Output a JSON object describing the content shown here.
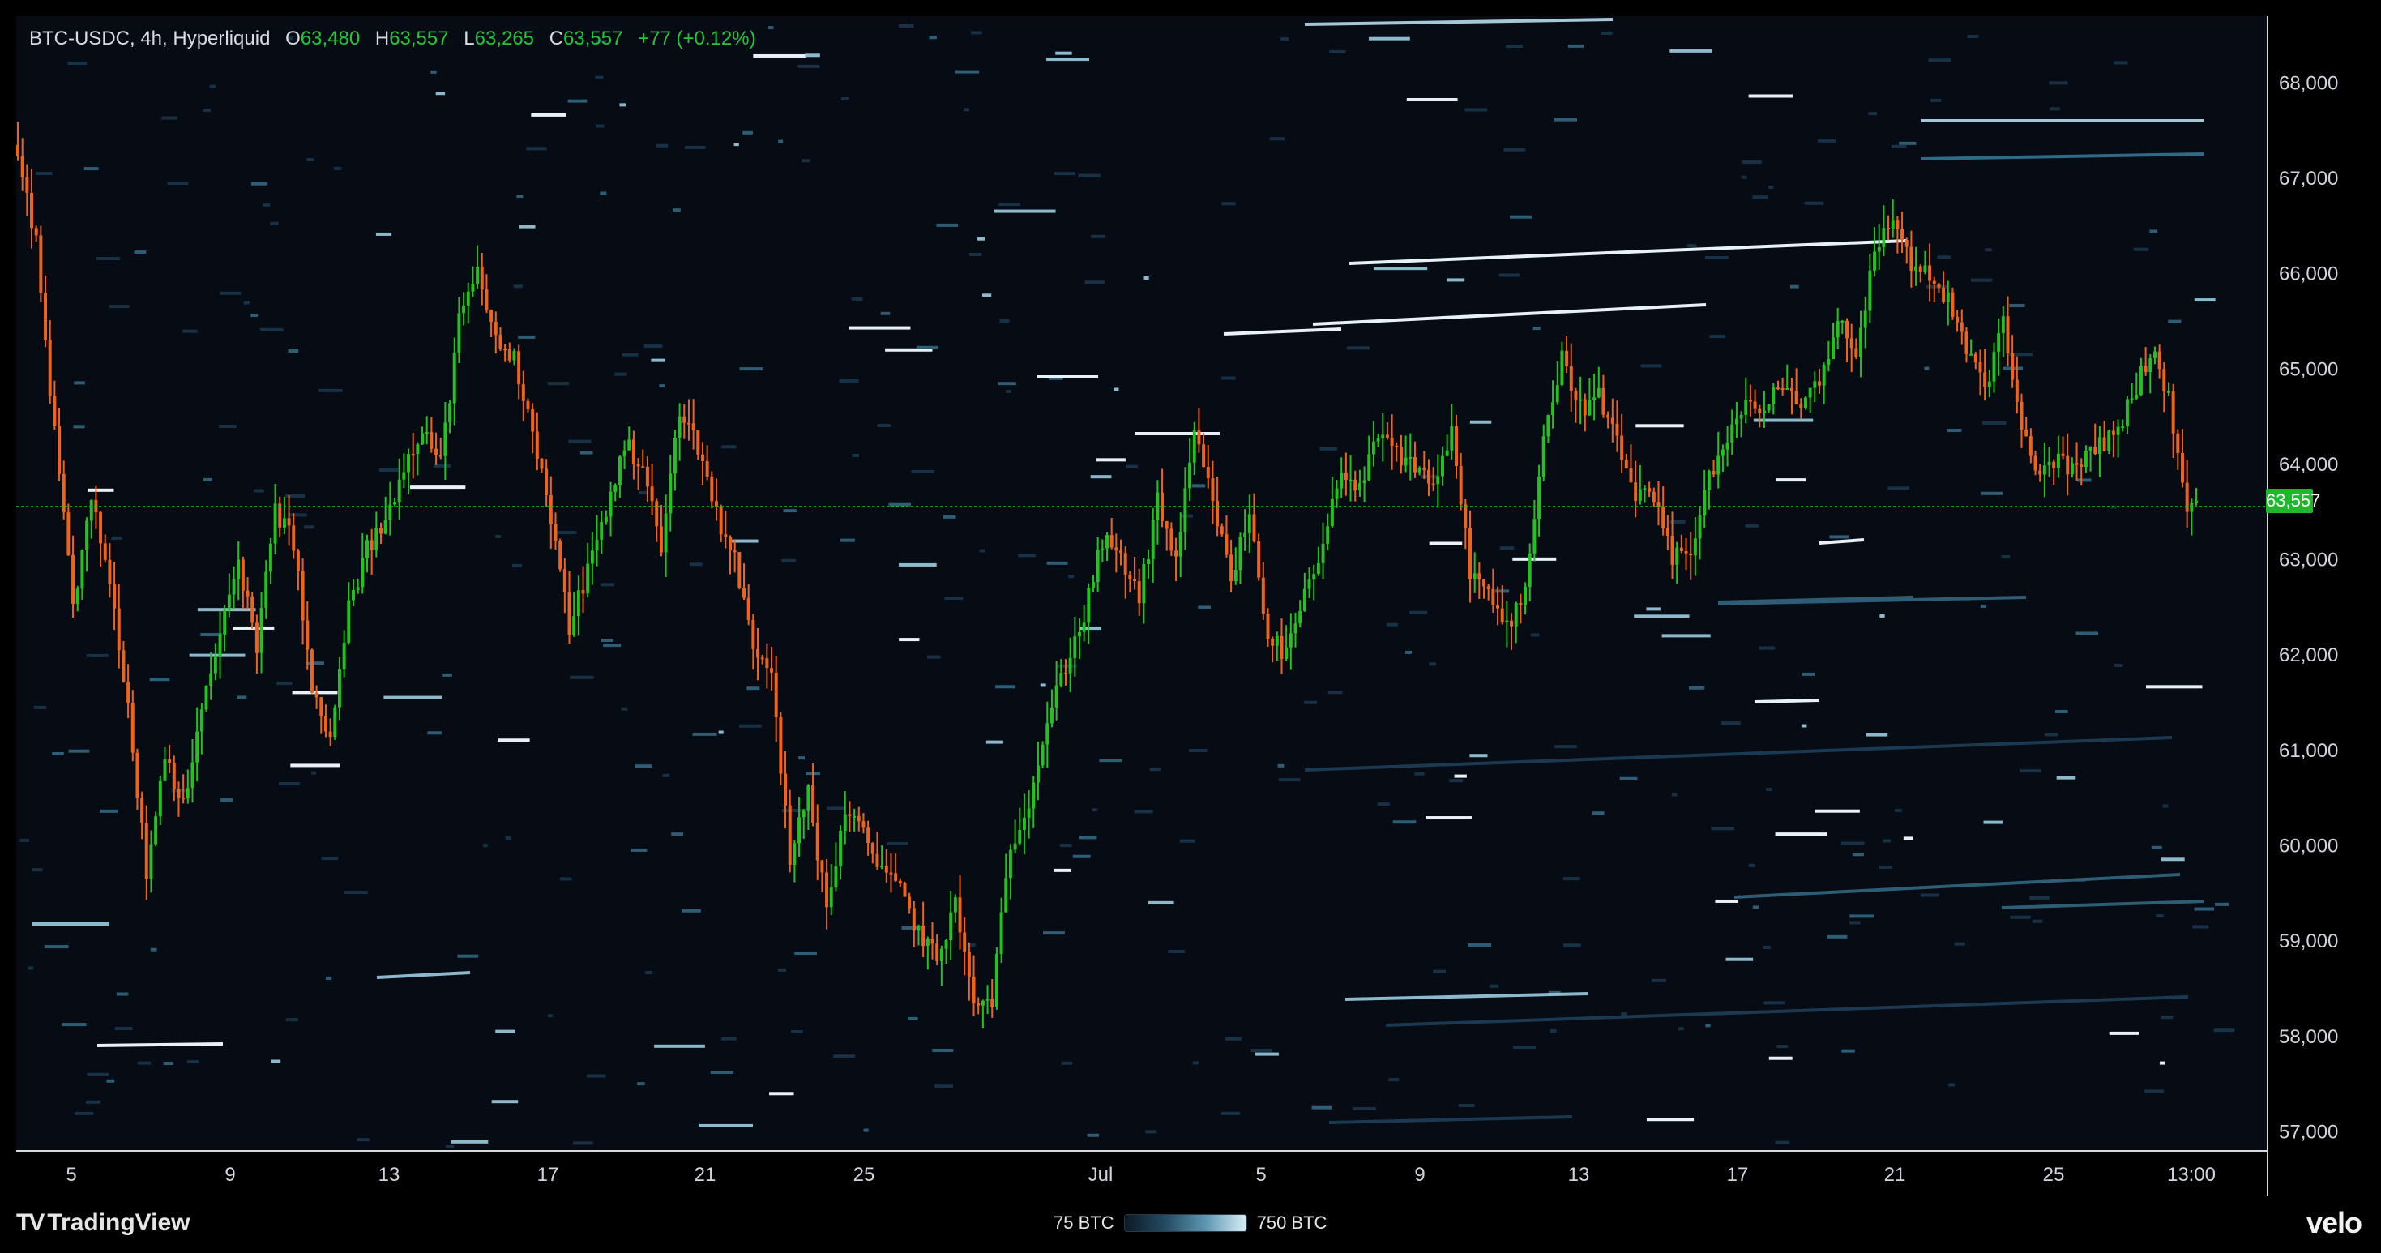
{
  "header": {
    "symbol": "BTC-USDC, 4h, Hyperliquid",
    "open_label": "O",
    "open": "63,480",
    "high_label": "H",
    "high": "63,557",
    "low_label": "L",
    "low": "63,265",
    "close_label": "C",
    "close": "63,557",
    "change": "+77 (+0.12%)"
  },
  "last_price_tag": "63,557",
  "footer": {
    "brand": "TradingView",
    "scale_min": "75 BTC",
    "scale_max": "750 BTC",
    "right_brand": "velo"
  },
  "colors": {
    "background": "#060b14",
    "up": "#22c21f",
    "down": "#f2631a",
    "liquidity_low": "#1b3a52",
    "liquidity_high": "#e8f2f6",
    "price_line": "#1eb82f"
  },
  "chart_data": {
    "type": "candlestick",
    "timeframe": "4h",
    "x_ticks": [
      "5",
      "9",
      "13",
      "17",
      "21",
      "25",
      "Jul",
      "5",
      "9",
      "13",
      "17",
      "21",
      "25",
      "13:00"
    ],
    "y_ticks": [
      57000,
      58000,
      59000,
      60000,
      61000,
      62000,
      63000,
      64000,
      65000,
      66000,
      67000,
      68000
    ],
    "ylim": [
      56800,
      68700
    ],
    "last_price": 63557,
    "close_path_keypoints": [
      [
        0,
        67200
      ],
      [
        4,
        66300
      ],
      [
        8,
        64300
      ],
      [
        12,
        62500
      ],
      [
        16,
        63600
      ],
      [
        20,
        62800
      ],
      [
        24,
        61500
      ],
      [
        28,
        59700
      ],
      [
        32,
        61000
      ],
      [
        36,
        60400
      ],
      [
        40,
        61400
      ],
      [
        44,
        62200
      ],
      [
        48,
        63000
      ],
      [
        52,
        62100
      ],
      [
        56,
        63500
      ],
      [
        60,
        63200
      ],
      [
        64,
        61600
      ],
      [
        68,
        61100
      ],
      [
        72,
        62500
      ],
      [
        76,
        63100
      ],
      [
        80,
        63400
      ],
      [
        84,
        64000
      ],
      [
        88,
        64400
      ],
      [
        92,
        64000
      ],
      [
        96,
        65500
      ],
      [
        100,
        66000
      ],
      [
        104,
        65300
      ],
      [
        108,
        65100
      ],
      [
        112,
        64400
      ],
      [
        116,
        63400
      ],
      [
        120,
        62300
      ],
      [
        124,
        62900
      ],
      [
        128,
        63500
      ],
      [
        132,
        64200
      ],
      [
        136,
        64000
      ],
      [
        140,
        63100
      ],
      [
        144,
        64600
      ],
      [
        148,
        64200
      ],
      [
        152,
        63500
      ],
      [
        156,
        63000
      ],
      [
        160,
        62100
      ],
      [
        164,
        61900
      ],
      [
        168,
        59800
      ],
      [
        172,
        60600
      ],
      [
        176,
        59300
      ],
      [
        180,
        60400
      ],
      [
        184,
        60100
      ],
      [
        188,
        59800
      ],
      [
        192,
        59500
      ],
      [
        196,
        59100
      ],
      [
        200,
        58800
      ],
      [
        204,
        59400
      ],
      [
        208,
        58300
      ],
      [
        212,
        58400
      ],
      [
        216,
        60000
      ],
      [
        220,
        60500
      ],
      [
        224,
        61300
      ],
      [
        228,
        61900
      ],
      [
        232,
        62400
      ],
      [
        236,
        63200
      ],
      [
        240,
        63000
      ],
      [
        244,
        62600
      ],
      [
        248,
        63600
      ],
      [
        252,
        63000
      ],
      [
        256,
        64300
      ],
      [
        260,
        63600
      ],
      [
        264,
        62800
      ],
      [
        268,
        63500
      ],
      [
        272,
        62200
      ],
      [
        276,
        62000
      ],
      [
        280,
        62600
      ],
      [
        284,
        63100
      ],
      [
        288,
        64000
      ],
      [
        292,
        63700
      ],
      [
        296,
        64300
      ],
      [
        300,
        64100
      ],
      [
        304,
        64000
      ],
      [
        308,
        63800
      ],
      [
        312,
        64300
      ],
      [
        316,
        62900
      ],
      [
        320,
        62600
      ],
      [
        324,
        62300
      ],
      [
        328,
        62700
      ],
      [
        332,
        64300
      ],
      [
        336,
        65100
      ],
      [
        340,
        64600
      ],
      [
        344,
        64700
      ],
      [
        348,
        64200
      ],
      [
        352,
        63700
      ],
      [
        356,
        63600
      ],
      [
        360,
        63000
      ],
      [
        364,
        63100
      ],
      [
        368,
        63900
      ],
      [
        372,
        64200
      ],
      [
        376,
        64700
      ],
      [
        380,
        64500
      ],
      [
        384,
        64900
      ],
      [
        388,
        64600
      ],
      [
        392,
        64900
      ],
      [
        396,
        65500
      ],
      [
        400,
        65200
      ],
      [
        404,
        66200
      ],
      [
        408,
        66600
      ],
      [
        412,
        66100
      ],
      [
        416,
        66000
      ],
      [
        420,
        65700
      ],
      [
        424,
        65200
      ],
      [
        428,
        64800
      ],
      [
        432,
        65500
      ],
      [
        436,
        64300
      ],
      [
        440,
        63900
      ],
      [
        444,
        64100
      ],
      [
        448,
        63900
      ],
      [
        452,
        64200
      ],
      [
        456,
        64300
      ],
      [
        460,
        64700
      ],
      [
        464,
        65200
      ],
      [
        468,
        64700
      ],
      [
        472,
        63500
      ],
      [
        474,
        63557
      ]
    ]
  }
}
